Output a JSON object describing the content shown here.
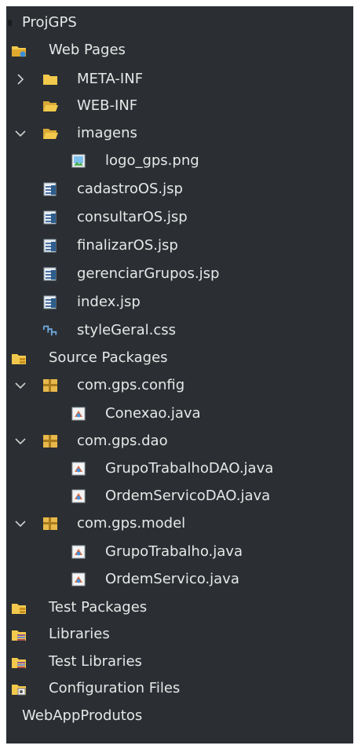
{
  "colors": {
    "panel_bg": "#2b2f33",
    "text": "#e7e7e7",
    "folder": "#f2c94c",
    "package": "#e8b94a"
  },
  "tree": {
    "project1": "ProjGPS",
    "web_pages": "Web Pages",
    "meta_inf": "META-INF",
    "web_inf": "WEB-INF",
    "imagens": "imagens",
    "logo": "logo_gps.png",
    "cadastro": "cadastroOS.jsp",
    "consultar": "consultarOS.jsp",
    "finalizar": "finalizarOS.jsp",
    "gerenciar": "gerenciarGrupos.jsp",
    "index": "index.jsp",
    "style": "styleGeral.css",
    "source_packages": "Source Packages",
    "pkg_config": "com.gps.config",
    "conexao": "Conexao.java",
    "pkg_dao": "com.gps.dao",
    "grupo_dao": "GrupoTrabalhoDAO.java",
    "ordem_dao": "OrdemServicoDAO.java",
    "pkg_model": "com.gps.model",
    "grupo_model": "GrupoTrabalho.java",
    "ordem_model": "OrdemServico.java",
    "test_packages": "Test Packages",
    "libraries": "Libraries",
    "test_libraries": "Test Libraries",
    "config_files": "Configuration Files",
    "project2": "WebAppProdutos"
  }
}
